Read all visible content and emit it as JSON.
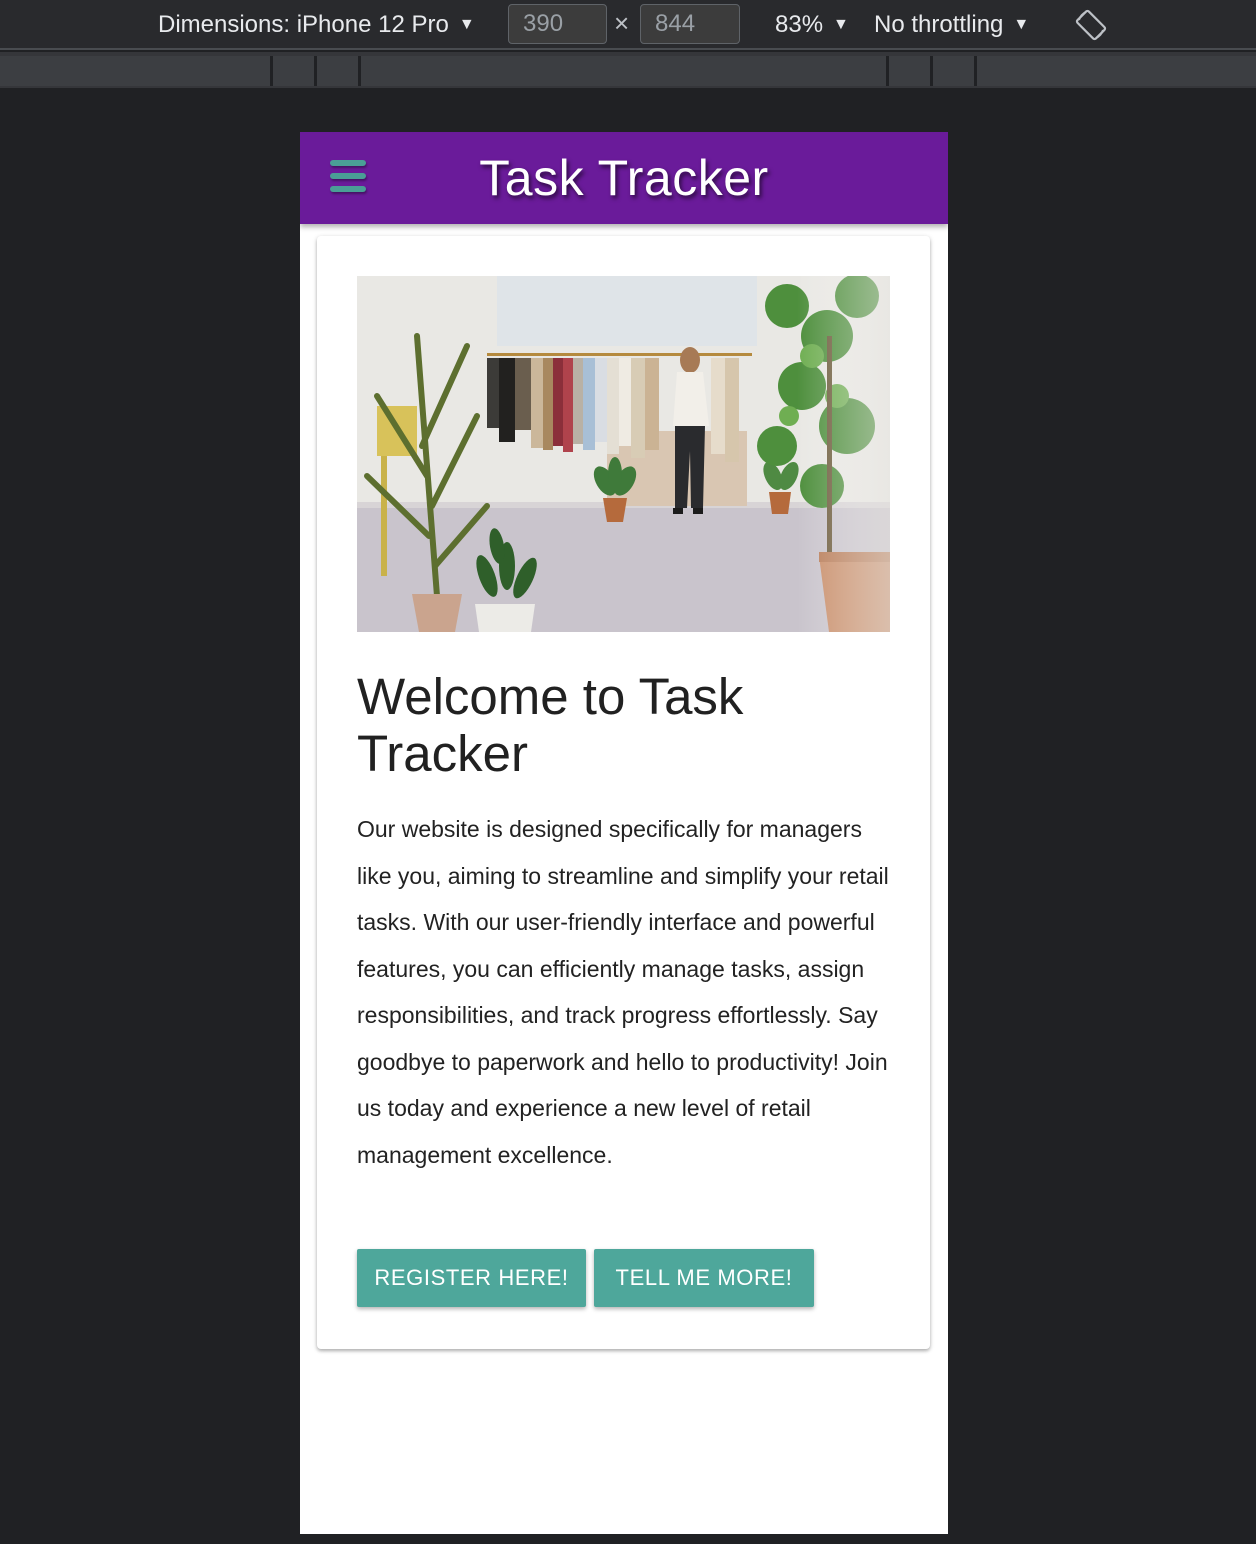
{
  "devtools": {
    "dimensions_label": "Dimensions: iPhone 12 Pro",
    "width_value": "390",
    "times": "×",
    "height_value": "844",
    "zoom": "83%",
    "throttling": "No throttling",
    "caret": "▼"
  },
  "app": {
    "title": "Task Tracker",
    "colors": {
      "header": "#6a1b9a",
      "accent": "#4ea79b"
    }
  },
  "card": {
    "title": "Welcome to Task Tracker",
    "body": "Our website is designed specifically for managers like you, aiming to streamline and simplify your retail tasks. With our user-friendly interface and powerful features, you can efficiently manage tasks, assign responsibilities, and track progress effortlessly. Say goodbye to paperwork and hello to productivity! Join us today and experience a new level of retail management excellence.",
    "buttons": {
      "register": "REGISTER HERE!",
      "more": "TELL ME MORE!"
    }
  }
}
